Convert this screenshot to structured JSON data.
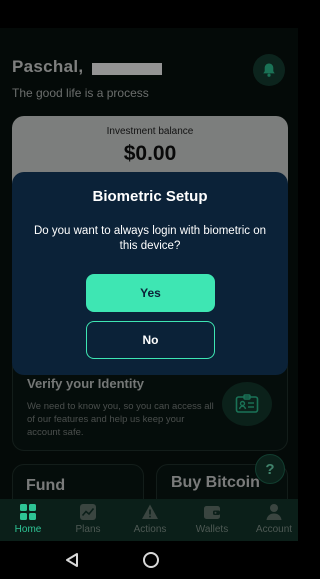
{
  "header": {
    "greeting": "Paschal,",
    "tagline": "The good life is a process"
  },
  "balance": {
    "label": "Investment balance",
    "value": "$0.00"
  },
  "verify": {
    "title": "Verify your Identity",
    "description": "We need to know you, so you can access all of our features and help us keep your account safe."
  },
  "quick_actions": {
    "fund": "Fund",
    "buy": "Buy Bitcoin",
    "help": "?"
  },
  "tabs": [
    {
      "label": "Home",
      "icon": "home-grid-icon",
      "active": true
    },
    {
      "label": "Plans",
      "icon": "chart-icon",
      "active": false
    },
    {
      "label": "Actions",
      "icon": "warning-icon",
      "active": false
    },
    {
      "label": "Wallets",
      "icon": "wallet-icon",
      "active": false
    },
    {
      "label": "Account",
      "icon": "person-icon",
      "active": false
    }
  ],
  "dialog": {
    "title": "Biometric Setup",
    "message": "Do you want to always login with biometric on this device?",
    "yes_label": "Yes",
    "no_label": "No"
  },
  "colors": {
    "accent": "#3ee6b3",
    "dialog_bg": "#0b2238",
    "background": "#07120f"
  }
}
